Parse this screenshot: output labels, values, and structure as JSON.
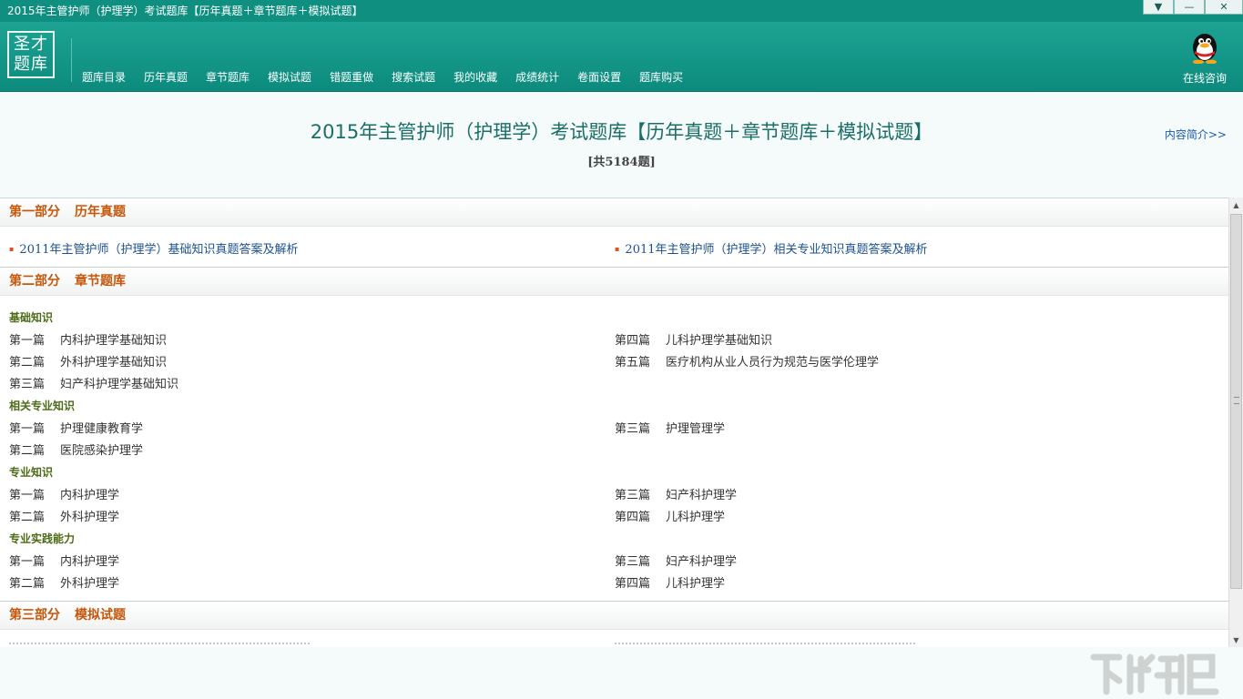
{
  "window": {
    "title": "2015年主管护师（护理学）考试题库【历年真题＋章节题库＋模拟试题】",
    "btn_menu": "▼",
    "btn_min": "—",
    "btn_close": "✕"
  },
  "header": {
    "logo_line1": "圣才",
    "logo_line2": "题库",
    "nav": [
      "题库目录",
      "历年真题",
      "章节题库",
      "模拟试题",
      "错题重做",
      "搜索试题",
      "我的收藏",
      "成绩统计",
      "卷面设置",
      "题库购买"
    ],
    "consult_label": "在线咨询",
    "consult_icon": "qq-penguin-icon"
  },
  "heading": {
    "title": "2015年主管护师（护理学）考试题库【历年真题＋章节题库＋模拟试题】",
    "count": "[共5184题]",
    "intro_link": "内容简介>>"
  },
  "sections": {
    "s1": {
      "title": "第一部分",
      "name": "历年真题",
      "items": [
        "2011年主管护师（护理学）基础知识真题答案及解析",
        "2011年主管护师（护理学）相关专业知识真题答案及解析"
      ]
    },
    "s2": {
      "title": "第二部分",
      "name": "章节题库",
      "groups": [
        {
          "name": "基础知识",
          "left": [
            [
              "第一篇",
              "内科护理学基础知识"
            ],
            [
              "第二篇",
              "外科护理学基础知识"
            ],
            [
              "第三篇",
              "妇产科护理学基础知识"
            ]
          ],
          "right": [
            [
              "第四篇",
              "儿科护理学基础知识"
            ],
            [
              "第五篇",
              "医疗机构从业人员行为规范与医学伦理学"
            ]
          ]
        },
        {
          "name": "相关专业知识",
          "left": [
            [
              "第一篇",
              "护理健康教育学"
            ],
            [
              "第二篇",
              "医院感染护理学"
            ]
          ],
          "right": [
            [
              "第三篇",
              "护理管理学"
            ]
          ]
        },
        {
          "name": "专业知识",
          "left": [
            [
              "第一篇",
              "内科护理学"
            ],
            [
              "第二篇",
              "外科护理学"
            ]
          ],
          "right": [
            [
              "第三篇",
              "妇产科护理学"
            ],
            [
              "第四篇",
              "儿科护理学"
            ]
          ]
        },
        {
          "name": "专业实践能力",
          "left": [
            [
              "第一篇",
              "内科护理学"
            ],
            [
              "第二篇",
              "外科护理学"
            ]
          ],
          "right": [
            [
              "第三篇",
              "妇产科护理学"
            ],
            [
              "第四篇",
              "儿科护理学"
            ]
          ]
        }
      ]
    },
    "s3": {
      "title": "第三部分",
      "name": "模拟试题"
    }
  },
  "colors": {
    "header": "#14998a",
    "section_title": "#c5560a",
    "link": "#1b4f8f",
    "subgroup": "#4d6a16"
  }
}
